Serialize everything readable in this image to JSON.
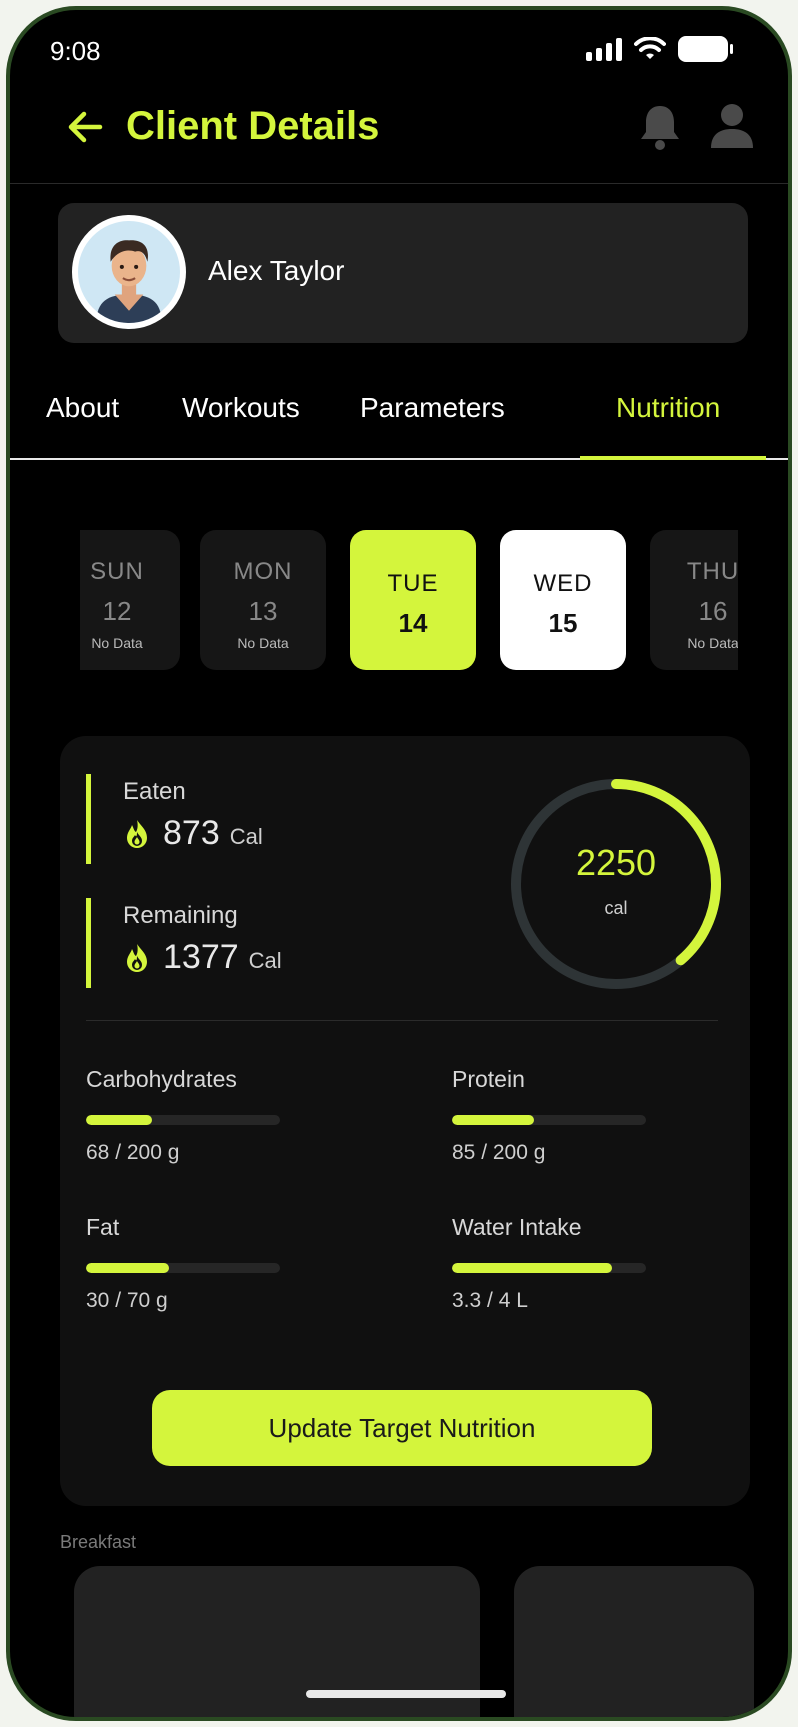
{
  "status_bar": {
    "time": "9:08"
  },
  "header": {
    "title": "Client Details",
    "back_icon": "arrow-left-icon",
    "notification_icon": "bell-icon",
    "profile_icon": "person-icon"
  },
  "client": {
    "name": "Alex Taylor"
  },
  "tabs": [
    {
      "label": "About"
    },
    {
      "label": "Workouts"
    },
    {
      "label": "Parameters"
    },
    {
      "label": "Nutrition",
      "active": true
    }
  ],
  "days": [
    {
      "name": "SUN",
      "number": "12",
      "note": "No Data"
    },
    {
      "name": "MON",
      "number": "13",
      "note": "No Data"
    },
    {
      "name": "TUE",
      "number": "14",
      "state": "selected"
    },
    {
      "name": "WED",
      "number": "15",
      "state": "today"
    },
    {
      "name": "THU",
      "number": "16",
      "note": "No Data"
    }
  ],
  "summary": {
    "eaten_label": "Eaten",
    "eaten_value": "873",
    "eaten_unit": "Cal",
    "remaining_label": "Remaining",
    "remaining_value": "1377",
    "remaining_unit": "Cal",
    "target_value": "2250",
    "target_unit": "cal",
    "progress_fraction": 0.388
  },
  "macros": [
    {
      "label": "Carbohydrates",
      "value": "68 / 200 g",
      "fraction": 0.34
    },
    {
      "label": "Protein",
      "value": "85 / 200 g",
      "fraction": 0.425
    },
    {
      "label": "Fat",
      "value": "30 / 70 g",
      "fraction": 0.4286
    },
    {
      "label": "Water Intake",
      "value": "3.3 / 4 L",
      "fraction": 0.825
    }
  ],
  "update_button": {
    "label": "Update Target Nutrition"
  },
  "meals": {
    "section_label": "Breakfast"
  },
  "colors": {
    "accent": "#d4f53c",
    "background": "#000000",
    "card": "#222222",
    "ring_track": "#2e3436"
  }
}
